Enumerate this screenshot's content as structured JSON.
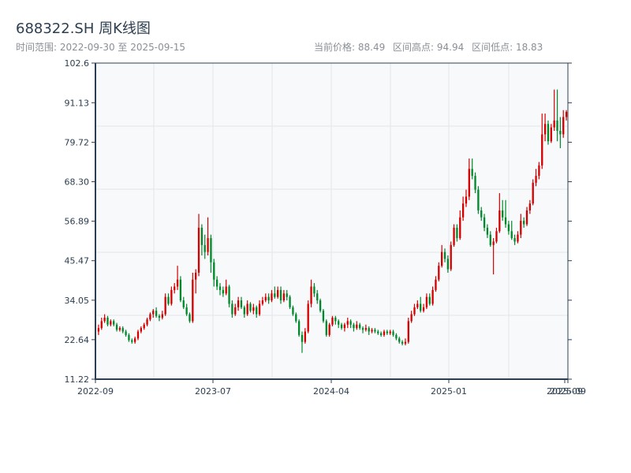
{
  "header": {
    "title": "688322.SH 周K线图",
    "range_text": "时间范围: 2022-09-30 至 2025-09-15",
    "current_price": "当前价格: 88.49",
    "range_high": "区间高点: 94.94",
    "range_low": "区间低点: 18.83"
  },
  "chart_data": {
    "type": "candlestick",
    "title": "688322.SH 周K线图",
    "ohlc_format": [
      "open",
      "high",
      "low",
      "close"
    ],
    "ylim": [
      11.22,
      102.6
    ],
    "y_ticks": [
      "102.6",
      "91.13",
      "79.72",
      "68.30",
      "56.89",
      "45.47",
      "34.05",
      "22.64",
      "11.22"
    ],
    "x_ticks": [
      "2022-09",
      "2023-07",
      "2024-04",
      "2025-01",
      "2025-09",
      "2025-09"
    ],
    "grid": true,
    "colors": {
      "up": "#d40000",
      "down": "#00892b",
      "plot_bg": "#f7f9fb",
      "axis": "#2c3e50",
      "grid": "#e3e6ea"
    },
    "candles": [
      [
        25,
        27,
        24,
        26
      ],
      [
        26,
        29,
        25.5,
        28
      ],
      [
        28,
        30,
        27.5,
        29
      ],
      [
        29,
        29.5,
        26.5,
        27
      ],
      [
        27,
        28.5,
        26.5,
        28
      ],
      [
        28,
        28.5,
        26.5,
        27
      ],
      [
        27,
        27.5,
        25,
        25.5
      ],
      [
        25.5,
        26.5,
        25,
        26
      ],
      [
        26,
        26.5,
        24.5,
        25
      ],
      [
        25,
        25.5,
        23.5,
        24
      ],
      [
        24,
        24.5,
        22,
        22.5
      ],
      [
        22.5,
        23,
        21.5,
        22
      ],
      [
        22,
        23.5,
        21.5,
        23
      ],
      [
        23,
        25.5,
        22.5,
        25
      ],
      [
        25,
        26.5,
        24.5,
        26
      ],
      [
        26,
        27.5,
        25.5,
        27
      ],
      [
        27,
        29,
        26.5,
        28.5
      ],
      [
        28.5,
        30.5,
        28,
        30
      ],
      [
        30,
        31.5,
        29,
        31
      ],
      [
        31,
        32,
        29,
        29.5
      ],
      [
        29.5,
        30,
        28,
        29
      ],
      [
        29,
        31,
        28.5,
        30
      ],
      [
        30,
        36,
        29.5,
        35
      ],
      [
        35,
        36,
        32.5,
        33
      ],
      [
        33,
        38,
        32.5,
        37
      ],
      [
        37,
        39,
        36,
        38
      ],
      [
        38,
        44,
        37,
        40
      ],
      [
        40,
        41,
        33.5,
        34
      ],
      [
        34,
        35,
        31.5,
        32
      ],
      [
        32,
        33,
        29.5,
        30
      ],
      [
        30,
        30.5,
        27.5,
        28
      ],
      [
        28,
        42,
        27.5,
        40
      ],
      [
        40,
        43,
        36,
        42
      ],
      [
        42,
        59,
        41,
        55
      ],
      [
        55,
        56,
        47,
        50
      ],
      [
        50,
        53,
        46,
        48
      ],
      [
        48,
        58,
        47,
        52
      ],
      [
        52,
        53,
        42,
        45
      ],
      [
        45,
        46,
        38,
        40
      ],
      [
        40,
        41,
        37,
        38
      ],
      [
        38,
        39,
        35.5,
        37
      ],
      [
        37,
        38,
        35,
        36
      ],
      [
        36,
        40,
        35.5,
        38
      ],
      [
        38,
        38.5,
        32,
        33
      ],
      [
        33,
        34,
        29,
        30
      ],
      [
        30,
        33,
        29.5,
        32
      ],
      [
        32,
        35,
        31,
        34
      ],
      [
        34,
        35,
        31.5,
        32
      ],
      [
        32,
        32.5,
        29,
        30
      ],
      [
        30,
        34,
        29.5,
        33
      ],
      [
        33,
        33.5,
        30.5,
        31
      ],
      [
        31,
        33,
        30,
        32
      ],
      [
        32,
        32.5,
        29,
        30
      ],
      [
        30,
        34,
        29.5,
        33
      ],
      [
        33,
        35,
        32.5,
        34
      ],
      [
        34,
        36,
        33.5,
        35
      ],
      [
        35,
        36,
        33,
        34
      ],
      [
        34,
        37,
        33.5,
        36
      ],
      [
        36,
        38,
        34.5,
        35
      ],
      [
        35,
        38,
        34.5,
        37
      ],
      [
        37,
        38,
        33,
        34
      ],
      [
        34,
        37,
        33.5,
        36
      ],
      [
        36,
        37,
        34,
        35
      ],
      [
        35,
        35.5,
        31.5,
        32
      ],
      [
        32,
        32.5,
        29.5,
        30
      ],
      [
        30,
        30.5,
        27.5,
        28
      ],
      [
        28,
        28.5,
        23.5,
        24
      ],
      [
        24,
        25,
        18.83,
        22
      ],
      [
        22,
        26,
        21.5,
        25
      ],
      [
        25,
        34,
        24.5,
        33
      ],
      [
        33,
        40,
        32,
        38
      ],
      [
        38,
        39,
        35,
        36
      ],
      [
        36,
        37,
        33,
        34
      ],
      [
        34,
        34.5,
        30.5,
        31
      ],
      [
        31,
        31.5,
        27.5,
        28
      ],
      [
        28,
        28.5,
        23.5,
        24
      ],
      [
        24,
        27.5,
        23.5,
        27
      ],
      [
        27,
        29.5,
        26.5,
        29
      ],
      [
        29,
        29.5,
        27,
        28
      ],
      [
        28,
        28.5,
        26,
        27
      ],
      [
        27,
        27.5,
        25.5,
        26
      ],
      [
        26,
        27.5,
        25,
        27
      ],
      [
        27,
        29,
        26,
        28
      ],
      [
        28,
        28.5,
        26,
        27
      ],
      [
        27,
        27.5,
        25,
        26
      ],
      [
        26,
        28,
        25.5,
        27
      ],
      [
        27,
        27.5,
        25.5,
        26
      ],
      [
        26,
        26.5,
        24.5,
        25.5
      ],
      [
        25.5,
        27,
        25,
        26
      ],
      [
        26,
        26.5,
        24,
        25
      ],
      [
        25,
        26,
        24.5,
        25.5
      ],
      [
        25.5,
        26,
        24.5,
        25
      ],
      [
        25,
        25.5,
        24,
        24.5
      ],
      [
        24.5,
        25,
        23.5,
        24
      ],
      [
        24,
        25.5,
        23.5,
        25
      ],
      [
        25,
        25.5,
        24,
        24.5
      ],
      [
        24.5,
        25.5,
        24,
        25
      ],
      [
        25,
        25.5,
        23.5,
        24
      ],
      [
        24,
        24.5,
        22.5,
        23
      ],
      [
        23,
        23.5,
        21.5,
        22
      ],
      [
        22,
        22.5,
        21,
        21.5
      ],
      [
        21.5,
        23,
        21,
        22
      ],
      [
        22,
        29,
        21.5,
        28
      ],
      [
        28,
        31,
        27.5,
        30
      ],
      [
        30,
        33,
        29.5,
        32
      ],
      [
        32,
        34,
        31.5,
        33
      ],
      [
        33,
        35,
        30.5,
        31
      ],
      [
        31,
        33,
        30.5,
        32
      ],
      [
        32,
        36,
        31.5,
        35
      ],
      [
        35,
        36,
        32.5,
        33
      ],
      [
        33,
        38,
        32.5,
        37
      ],
      [
        37,
        41,
        36.5,
        40
      ],
      [
        40,
        45,
        39.5,
        44
      ],
      [
        44,
        50,
        43.5,
        48
      ],
      [
        48,
        49,
        45,
        46
      ],
      [
        46,
        47,
        42,
        43
      ],
      [
        43,
        51,
        42.5,
        50
      ],
      [
        50,
        56,
        49.5,
        55
      ],
      [
        55,
        56,
        51,
        52
      ],
      [
        52,
        60,
        51.5,
        58
      ],
      [
        58,
        64,
        57,
        62
      ],
      [
        62,
        66,
        61,
        64
      ],
      [
        64,
        75,
        63,
        72
      ],
      [
        72,
        75,
        69,
        70
      ],
      [
        70,
        71,
        65,
        66
      ],
      [
        66,
        67,
        59,
        60
      ],
      [
        60,
        61,
        57,
        58
      ],
      [
        58,
        59,
        54,
        55
      ],
      [
        55,
        56,
        52,
        53
      ],
      [
        53,
        54,
        49.5,
        50
      ],
      [
        50,
        52,
        41.5,
        51
      ],
      [
        51,
        55,
        50.5,
        54
      ],
      [
        54,
        65,
        53.5,
        60
      ],
      [
        60,
        63,
        57,
        58
      ],
      [
        58,
        63,
        55,
        56
      ],
      [
        56,
        57,
        53,
        54
      ],
      [
        54,
        57,
        51.5,
        52
      ],
      [
        52,
        53,
        50,
        51
      ],
      [
        51,
        54,
        50.5,
        53
      ],
      [
        53,
        59,
        52,
        57
      ],
      [
        57,
        58,
        55,
        56
      ],
      [
        56,
        61,
        55.5,
        60
      ],
      [
        60,
        63,
        59,
        62
      ],
      [
        62,
        69,
        61.5,
        68
      ],
      [
        68,
        72,
        67,
        70
      ],
      [
        70,
        74,
        69,
        73
      ],
      [
        73,
        88,
        72,
        82
      ],
      [
        82,
        88,
        80,
        85
      ],
      [
        85,
        86,
        79,
        80
      ],
      [
        80,
        85,
        79.5,
        84
      ],
      [
        84,
        94.94,
        83,
        86
      ],
      [
        86,
        94.94,
        80,
        83
      ],
      [
        83,
        87,
        78,
        82
      ],
      [
        82,
        89,
        81,
        87
      ],
      [
        87,
        89,
        86,
        88.49
      ]
    ]
  }
}
